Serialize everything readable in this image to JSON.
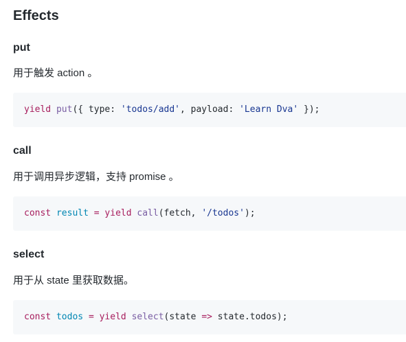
{
  "heading": "Effects",
  "sections": [
    {
      "title": "put",
      "description": "用于触发 action 。",
      "code": [
        {
          "text": "yield",
          "kind": "keyword"
        },
        {
          "text": " ",
          "kind": "plain"
        },
        {
          "text": "put",
          "kind": "function"
        },
        {
          "text": "({ type: ",
          "kind": "plain"
        },
        {
          "text": "'todos/add'",
          "kind": "string"
        },
        {
          "text": ", payload: ",
          "kind": "plain"
        },
        {
          "text": "'Learn Dva'",
          "kind": "string"
        },
        {
          "text": " });",
          "kind": "plain"
        }
      ]
    },
    {
      "title": "call",
      "description": "用于调用异步逻辑，支持 promise 。",
      "code": [
        {
          "text": "const",
          "kind": "keyword"
        },
        {
          "text": " ",
          "kind": "plain"
        },
        {
          "text": "result",
          "kind": "variable"
        },
        {
          "text": " ",
          "kind": "plain"
        },
        {
          "text": "=",
          "kind": "operator"
        },
        {
          "text": " ",
          "kind": "plain"
        },
        {
          "text": "yield",
          "kind": "keyword"
        },
        {
          "text": " ",
          "kind": "plain"
        },
        {
          "text": "call",
          "kind": "function"
        },
        {
          "text": "(fetch, ",
          "kind": "plain"
        },
        {
          "text": "'/todos'",
          "kind": "string"
        },
        {
          "text": ");",
          "kind": "plain"
        }
      ]
    },
    {
      "title": "select",
      "description": "用于从 state 里获取数据。",
      "code": [
        {
          "text": "const",
          "kind": "keyword"
        },
        {
          "text": " ",
          "kind": "plain"
        },
        {
          "text": "todos",
          "kind": "variable"
        },
        {
          "text": " ",
          "kind": "plain"
        },
        {
          "text": "=",
          "kind": "operator"
        },
        {
          "text": " ",
          "kind": "plain"
        },
        {
          "text": "yield",
          "kind": "keyword"
        },
        {
          "text": " ",
          "kind": "plain"
        },
        {
          "text": "select",
          "kind": "function"
        },
        {
          "text": "(state ",
          "kind": "plain"
        },
        {
          "text": "=>",
          "kind": "operator"
        },
        {
          "text": " state.todos);",
          "kind": "plain"
        }
      ]
    }
  ],
  "colors": {
    "text": "#24292e",
    "code_background": "#f6f8fa",
    "keyword": "#a71d5d",
    "function": "#795da3",
    "string": "#183691",
    "variable": "#0086b3"
  }
}
